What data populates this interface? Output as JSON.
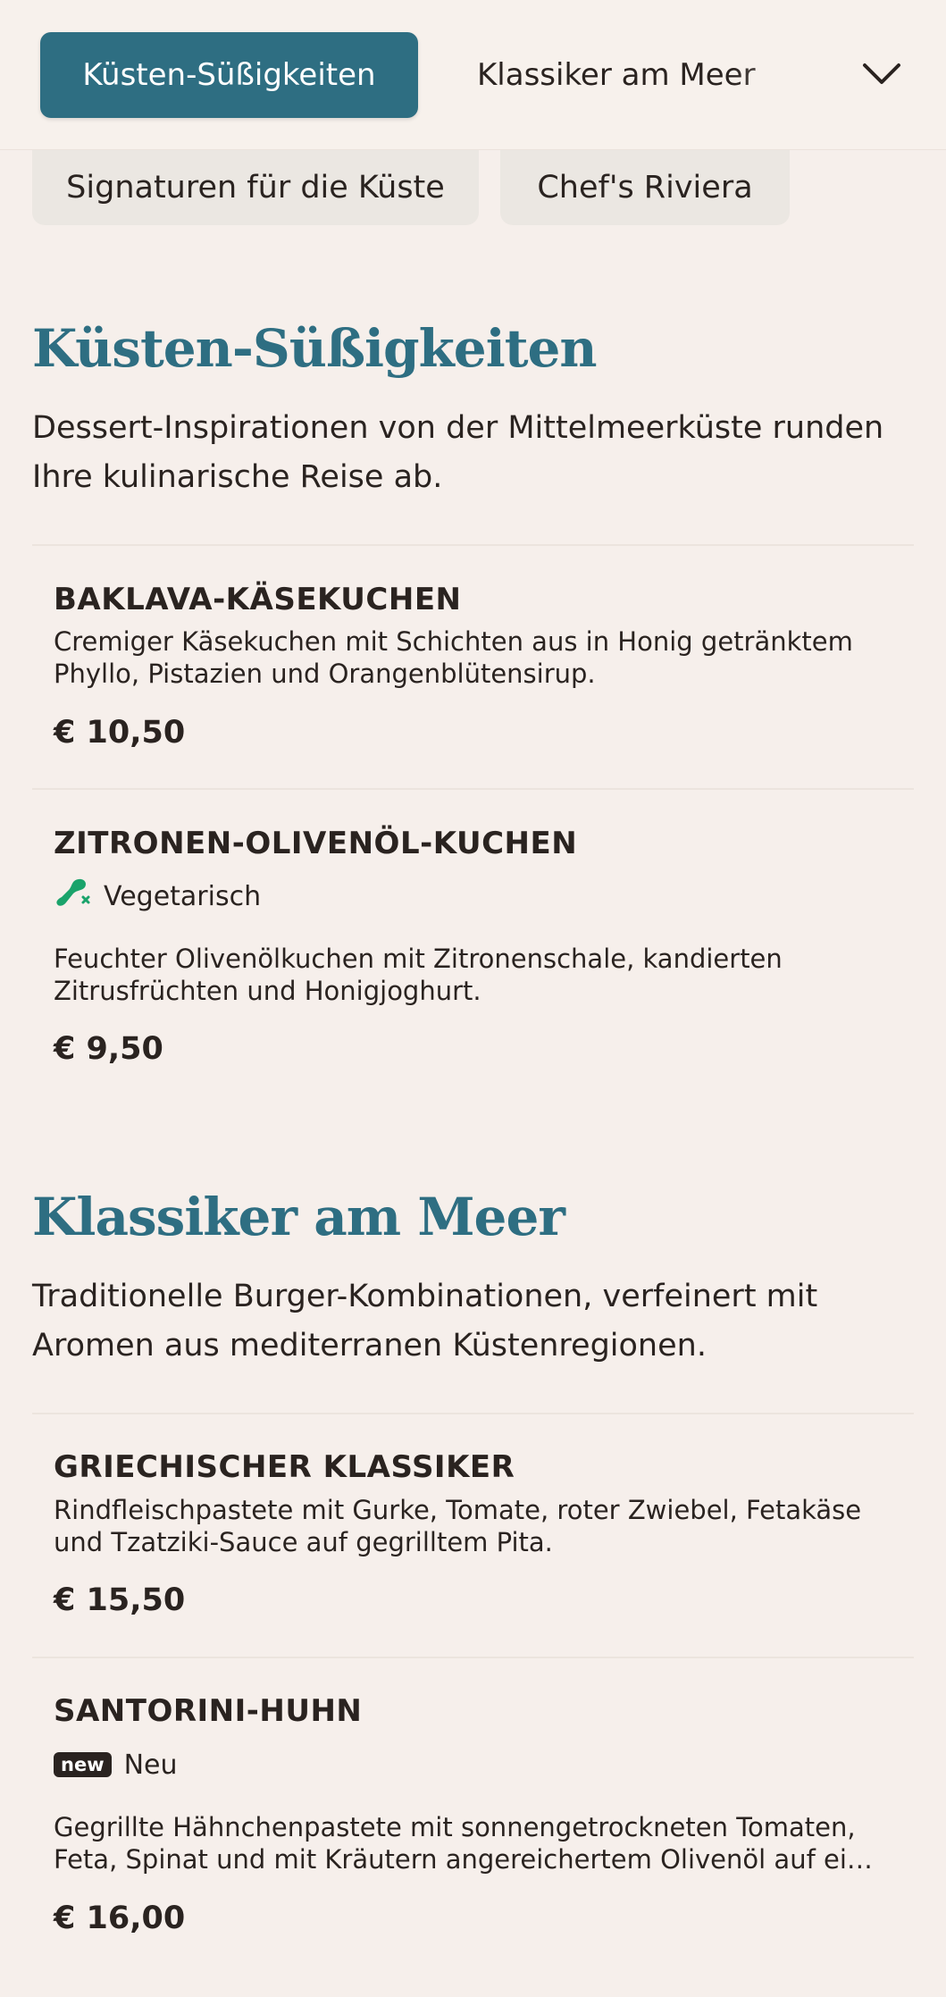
{
  "nav": {
    "tabs": [
      {
        "label": "Küsten-Süßigkeiten",
        "active": true
      },
      {
        "label": "Klassiker am Meer",
        "active": false
      }
    ],
    "more_tabs": [
      {
        "label": "Signaturen für die Küste"
      },
      {
        "label": "Chef's Riviera"
      }
    ]
  },
  "sections": [
    {
      "title": "Küsten-Süßigkeiten",
      "description": "Dessert-Inspirationen von der Mittelmeerküste runden Ihre kulinarische Reise ab.",
      "items": [
        {
          "name": "BAKLAVA-KÄSEKUCHEN",
          "description": "Cremiger Käsekuchen mit Schichten aus in Honig getränktem Phyllo, Pistazien und Orangenblütensirup.",
          "price": "€ 10,50"
        },
        {
          "name": "ZITRONEN-OLIVENÖL-KUCHEN",
          "tag": {
            "label": "Vegetarisch",
            "icon": "vegetarian-icon",
            "color": "#1aa36b"
          },
          "description": "Feuchter Olivenölkuchen mit Zitronenschale, kandierten Zitrusfrüchten und Honigjoghurt.",
          "price": "€ 9,50"
        }
      ]
    },
    {
      "title": "Klassiker am Meer",
      "description": "Traditionelle Burger-Kombinationen, verfeinert mit Aromen aus mediterranen Küstenregionen.",
      "items": [
        {
          "name": "GRIECHISCHER KLASSIKER",
          "description": "Rindfleischpastete mit Gurke, Tomate, roter Zwiebel, Fetakäse und Tzatziki-Sauce auf gegrilltem Pita.",
          "price": "€ 15,50"
        },
        {
          "name": "SANTORINI-HUHN",
          "tag": {
            "badge": "new",
            "label": "Neu"
          },
          "description_line1": "Gegrillte Hähnchenpastete mit sonnengetrockneten Tomaten,",
          "description_line2": "Feta, Spinat und mit Kräutern angereichertem Olivenöl auf eine...",
          "price": "€ 16,00"
        }
      ]
    }
  ],
  "colors": {
    "accent": "#2e6e82",
    "background": "#f6efeb",
    "vegetarian": "#1aa36b"
  }
}
